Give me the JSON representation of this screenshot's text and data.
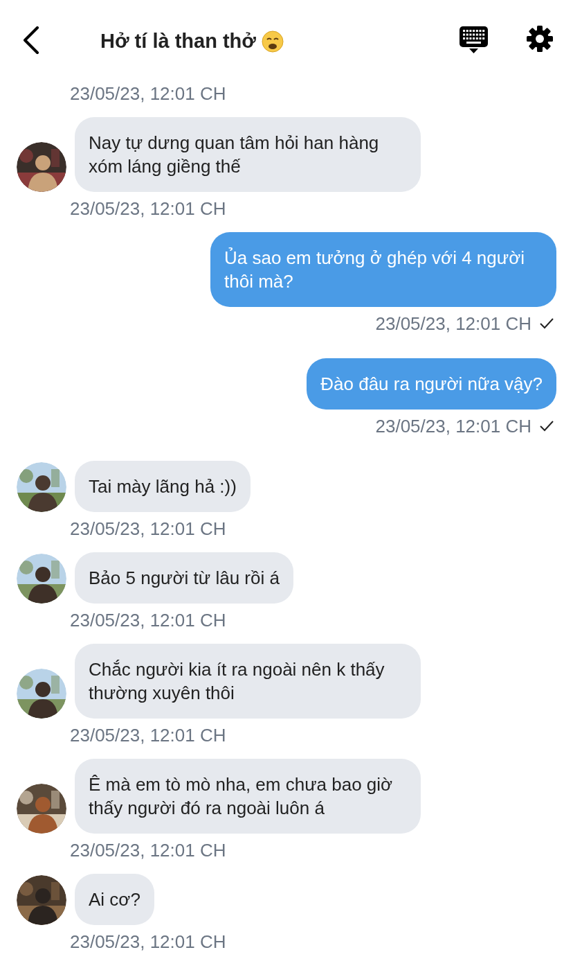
{
  "header": {
    "title": "Hở tí là than thở"
  },
  "messages": [
    {
      "kind": "timestamp_only",
      "time": "23/05/23, 12:01 CH"
    },
    {
      "kind": "incoming",
      "text": "Nay tự dưng quan tâm hỏi han hàng xóm láng giềng thế",
      "time": "23/05/23, 12:01 CH"
    },
    {
      "kind": "outgoing",
      "text": "Ủa sao em tưởng ở ghép với 4 người thôi mà?",
      "time": "23/05/23, 12:01 CH",
      "delivered": true
    },
    {
      "kind": "outgoing",
      "text": "Đào đâu ra người nữa vậy?",
      "time": "23/05/23, 12:01 CH",
      "delivered": true
    },
    {
      "kind": "incoming",
      "text": "Tai mày lãng hả :))",
      "time": "23/05/23, 12:01 CH"
    },
    {
      "kind": "incoming",
      "text": "Bảo 5 người từ lâu rồi á",
      "time": "23/05/23, 12:01 CH"
    },
    {
      "kind": "incoming",
      "text": "Chắc người kia ít ra ngoài nên k thấy thường xuyên thôi",
      "time": "23/05/23, 12:01 CH"
    },
    {
      "kind": "incoming",
      "text": "Ê mà em tò mò nha, em chưa bao giờ thấy người đó ra ngoài luôn á",
      "time": "23/05/23, 12:01 CH"
    },
    {
      "kind": "incoming",
      "text": "Ai cơ?",
      "time": "23/05/23, 12:01 CH"
    }
  ]
}
